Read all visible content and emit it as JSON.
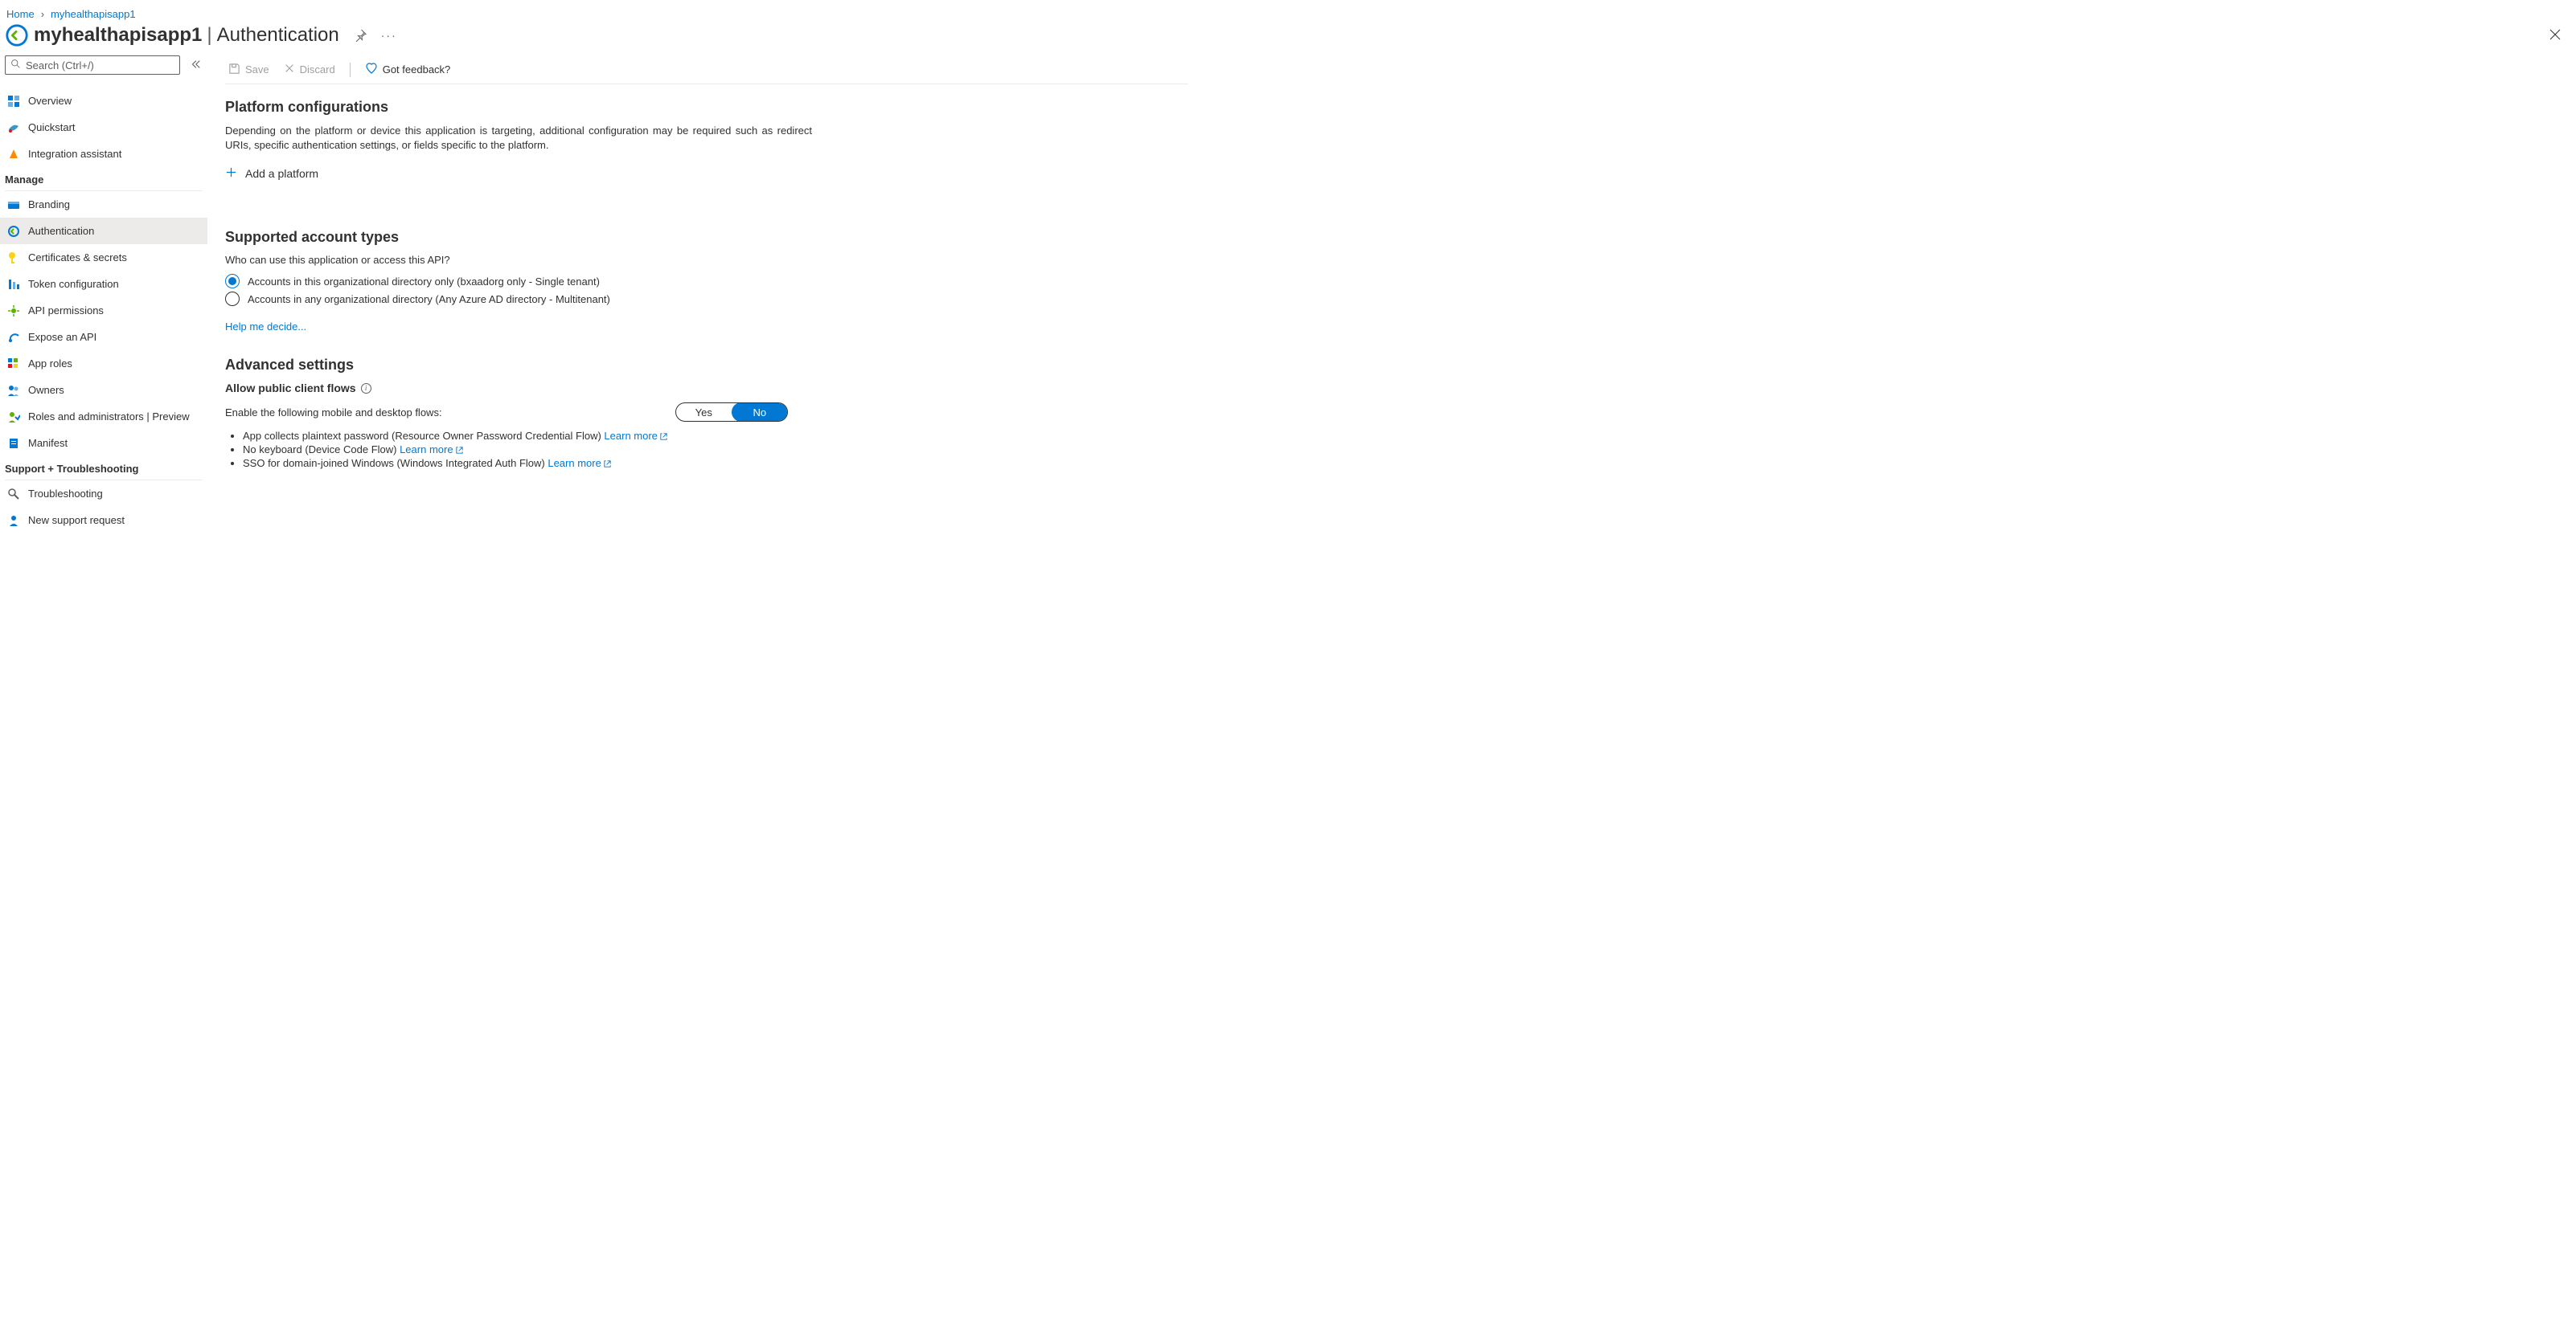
{
  "breadcrumb": {
    "home": "Home",
    "item": "myhealthapisapp1"
  },
  "header": {
    "title": "myhealthapisapp1",
    "subpage": "Authentication"
  },
  "search": {
    "placeholder": "Search (Ctrl+/)"
  },
  "nav": {
    "top": [
      {
        "id": "overview",
        "label": "Overview"
      },
      {
        "id": "quickstart",
        "label": "Quickstart"
      },
      {
        "id": "integration-assistant",
        "label": "Integration assistant"
      }
    ],
    "manage_header": "Manage",
    "manage": [
      {
        "id": "branding",
        "label": "Branding"
      },
      {
        "id": "authentication",
        "label": "Authentication",
        "active": true
      },
      {
        "id": "certificates-secrets",
        "label": "Certificates & secrets"
      },
      {
        "id": "token-configuration",
        "label": "Token configuration"
      },
      {
        "id": "api-permissions",
        "label": "API permissions"
      },
      {
        "id": "expose-an-api",
        "label": "Expose an API"
      },
      {
        "id": "app-roles",
        "label": "App roles"
      },
      {
        "id": "owners",
        "label": "Owners"
      },
      {
        "id": "roles-and-administrators",
        "label": "Roles and administrators | Preview"
      },
      {
        "id": "manifest",
        "label": "Manifest"
      }
    ],
    "support_header": "Support + Troubleshooting",
    "support": [
      {
        "id": "troubleshooting",
        "label": "Troubleshooting"
      },
      {
        "id": "new-support-request",
        "label": "New support request"
      }
    ]
  },
  "cmd": {
    "save": "Save",
    "discard": "Discard",
    "feedback": "Got feedback?"
  },
  "platform": {
    "heading": "Platform configurations",
    "desc": "Depending on the platform or device this application is targeting, additional configuration may be required such as redirect URIs, specific authentication settings, or fields specific to the platform.",
    "add": "Add a platform"
  },
  "accounts": {
    "heading": "Supported account types",
    "question": "Who can use this application or access this API?",
    "opt_single": "Accounts in this organizational directory only (bxaadorg only - Single tenant)",
    "opt_multi": "Accounts in any organizational directory (Any Azure AD directory - Multitenant)",
    "help": "Help me decide..."
  },
  "advanced": {
    "heading": "Advanced settings",
    "public_flows": "Allow public client flows",
    "enable_text": "Enable the following mobile and desktop flows:",
    "yes": "Yes",
    "no": "No",
    "flow1_text": "App collects plaintext password (Resource Owner Password Credential Flow) ",
    "flow2_text": "No keyboard (Device Code Flow) ",
    "flow3_text": "SSO for domain-joined Windows (Windows Integrated Auth Flow) ",
    "learn_more": "Learn more"
  }
}
